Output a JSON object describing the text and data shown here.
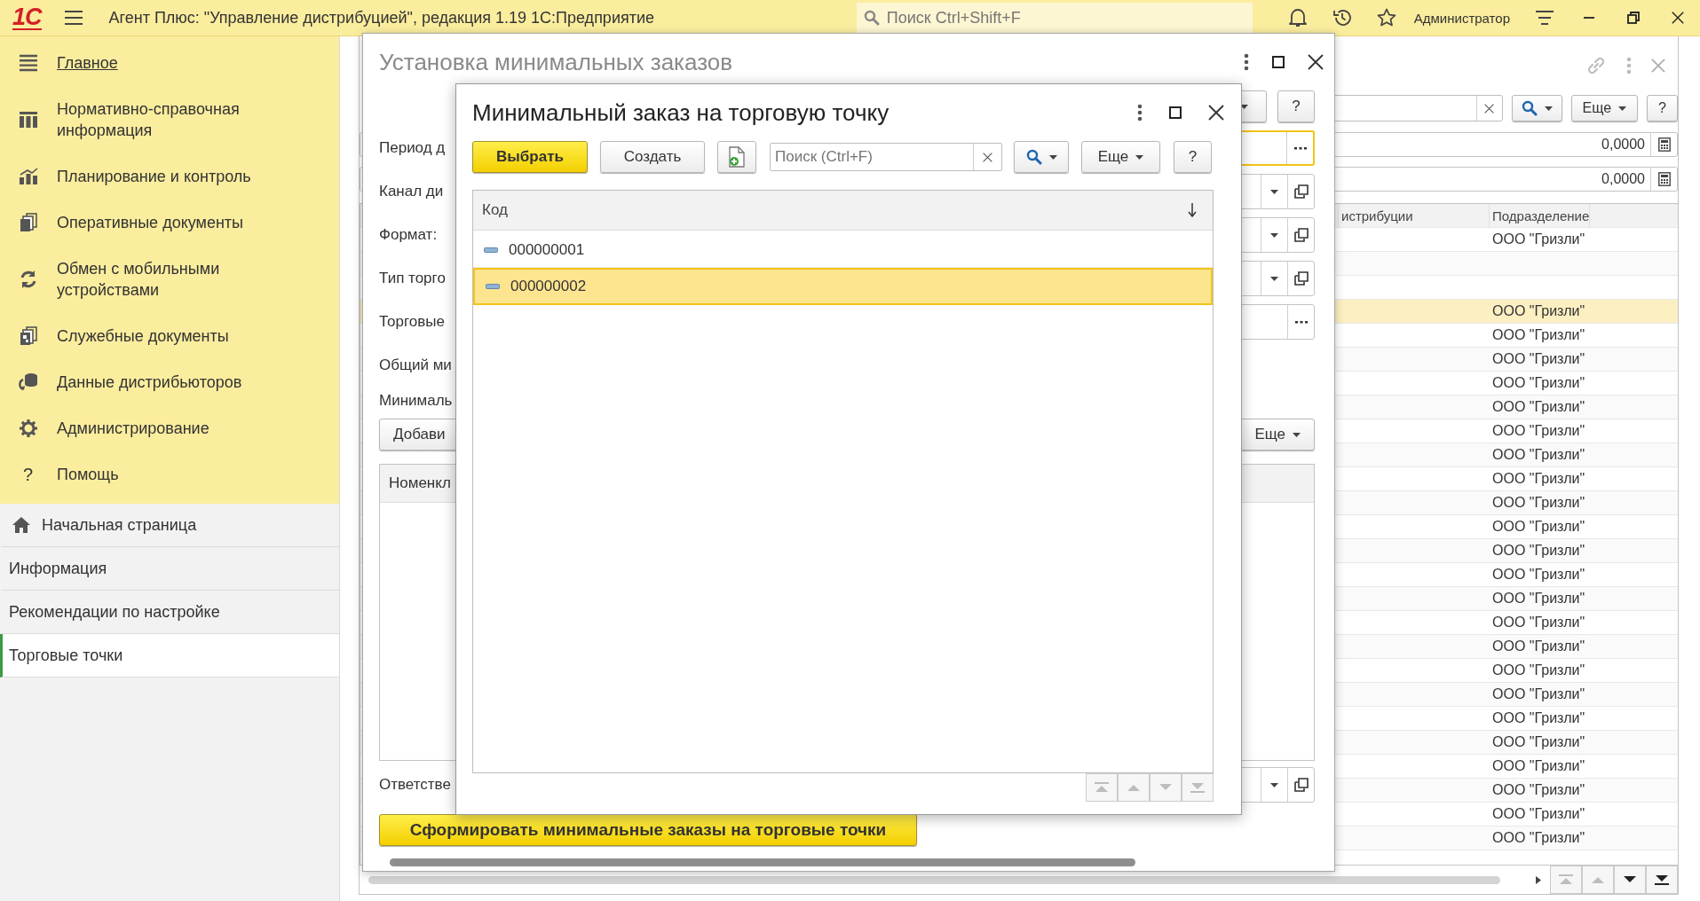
{
  "app_bar": {
    "logo": "1С",
    "title": "Агент Плюс: \"Управление дистрибуцией\", редакция 1.19 1С:Предприятие",
    "search": {
      "placeholder": "Поиск Ctrl+Shift+F"
    },
    "user": "Администратор"
  },
  "sidebar": {
    "sections": [
      {
        "label": "Главное",
        "selected": true
      },
      {
        "label": "Нормативно-справочная информация",
        "selected": false
      },
      {
        "label": "Планирование и контроль",
        "selected": false
      },
      {
        "label": "Оперативные документы",
        "selected": false
      },
      {
        "label": "Обмен с мобильными устройствами",
        "selected": false
      },
      {
        "label": "Служебные документы",
        "selected": false
      },
      {
        "label": "Данные дистрибьюторов",
        "selected": false
      },
      {
        "label": "Администрирование",
        "selected": false
      },
      {
        "label": "Помощь",
        "selected": false,
        "glyph": "?"
      }
    ],
    "open_windows": [
      {
        "label": "Начальная страница",
        "kind": "home",
        "selected": false
      },
      {
        "label": "Информация",
        "kind": "plain",
        "selected": false
      },
      {
        "label": "Рекомендации по настройке",
        "kind": "plain",
        "selected": false
      },
      {
        "label": "Торговые точки",
        "kind": "plain",
        "selected": true
      }
    ]
  },
  "background_form": {
    "toolbar": {
      "more_button": "Еще",
      "help_button": "?"
    },
    "number_fields": [
      "0,0000",
      "0,0000"
    ],
    "table": {
      "columns": [
        "истрибуции",
        "Подразделение"
      ],
      "rows": [
        {
          "division": "ООО \"Гризли\"",
          "selected": false
        },
        {
          "selected": false
        },
        {
          "selected": false
        },
        {
          "division": "ООО \"Гризли\"",
          "selected": true
        },
        {
          "division": "ООО \"Гризли\"",
          "selected": false
        },
        {
          "division": "ООО \"Гризли\"",
          "selected": false
        },
        {
          "division": "ООО \"Гризли\"",
          "selected": false
        },
        {
          "division": "ООО \"Гризли\"",
          "selected": false
        },
        {
          "division": "ООО \"Гризли\"",
          "selected": false
        },
        {
          "division": "ООО \"Гризли\"",
          "selected": false
        },
        {
          "division": "ООО \"Гризли\"",
          "selected": false
        },
        {
          "division": "ООО \"Гризли\"",
          "selected": false
        },
        {
          "division": "ООО \"Гризли\"",
          "selected": false
        },
        {
          "division": "ООО \"Гризли\"",
          "selected": false
        },
        {
          "division": "ООО \"Гризли\"",
          "selected": false
        },
        {
          "division": "ООО \"Гризли\"",
          "selected": false
        },
        {
          "division": "ООО \"Гризли\"",
          "selected": false
        },
        {
          "division": "ООО \"Гризли\"",
          "selected": false
        },
        {
          "division": "ООО \"Гризли\"",
          "selected": false
        },
        {
          "division": "ООО \"Гризли\"",
          "selected": false
        },
        {
          "division": "ООО \"Гризли\"",
          "selected": false
        },
        {
          "division": "ООО \"Гризли\"",
          "selected": false
        },
        {
          "division": "ООО \"Гризли\"",
          "selected": false
        },
        {
          "division": "ООО \"Гризли\"",
          "selected": false
        },
        {
          "division": "ООО \"Гризли\"",
          "selected": false
        },
        {
          "division": "ООО \"Гризли\"",
          "selected": false
        }
      ]
    },
    "nav_buttons": [
      {
        "disabled": true
      },
      {
        "disabled": true
      },
      {
        "disabled": false
      },
      {
        "disabled": false
      }
    ]
  },
  "settings_dialog": {
    "title": "Установка минимальных заказов",
    "help_button": "?",
    "fields": [
      {
        "label": "Период д",
        "kind": "choice",
        "focused": true
      },
      {
        "label": "Канал ди",
        "kind": "dropdown"
      },
      {
        "label": "Формат:",
        "kind": "dropdown"
      },
      {
        "label": "Тип торго",
        "kind": "dropdown"
      },
      {
        "label": "Торговые",
        "kind": "choice",
        "focused": false
      },
      {
        "label": "Общий ми",
        "kind": "label"
      }
    ],
    "orders_label": "Минималь",
    "add_button": "Добави",
    "more_button": "Еще",
    "table": {
      "columns": [
        "Номенкл"
      ]
    },
    "responsible": {
      "label": "Ответстве",
      "kind": "dropdown"
    },
    "generate_button": "Сформировать минимальные заказы на торговые точки"
  },
  "picker_dialog": {
    "title": "Минимальный заказ на торговую точку",
    "toolbar": {
      "select_button": "Выбрать",
      "create_button": "Создать",
      "search": {
        "placeholder": "Поиск (Ctrl+F)"
      },
      "more_button": "Еще",
      "help_button": "?"
    },
    "table": {
      "columns": [
        "Код"
      ],
      "rows": [
        {
          "code": "000000001",
          "selected": false
        },
        {
          "code": "000000002",
          "selected": true
        }
      ]
    },
    "nav_buttons": [
      {
        "disabled": true
      },
      {
        "disabled": true
      },
      {
        "disabled": true
      },
      {
        "disabled": true
      }
    ]
  }
}
